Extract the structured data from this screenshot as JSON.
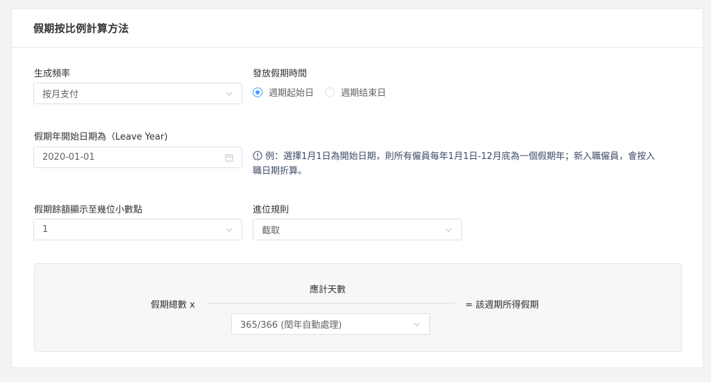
{
  "card": {
    "title": "假期按比例計算方法"
  },
  "frequency": {
    "label": "生成頻率",
    "value": "按月支付"
  },
  "issue_time": {
    "label": "發放假期時間",
    "options": [
      {
        "label": "週期起始日",
        "checked": true
      },
      {
        "label": "週期结束日",
        "checked": false
      }
    ]
  },
  "leave_year": {
    "label": "假期年開始日期為（Leave Year)",
    "value": "2020-01-01",
    "hint_line1": "例：選擇1月1日為開始日期，則所有僱員每年1月1日-12月底為一個假期年；新入職僱員，會按入",
    "hint_line2": "職日期折算。"
  },
  "decimal": {
    "label": "假期餘額顯示至幾位小數點",
    "value": "1"
  },
  "rounding": {
    "label": "進位規則",
    "value": "截取"
  },
  "formula": {
    "left": "假期總數 x",
    "numerator": "應計天數",
    "denominator_value": "365/366 (閏年自動處理)",
    "right": "= 該週期所得假期"
  },
  "colors": {
    "accent": "#409eff",
    "border": "#dcdfe6",
    "text": "#303133"
  }
}
